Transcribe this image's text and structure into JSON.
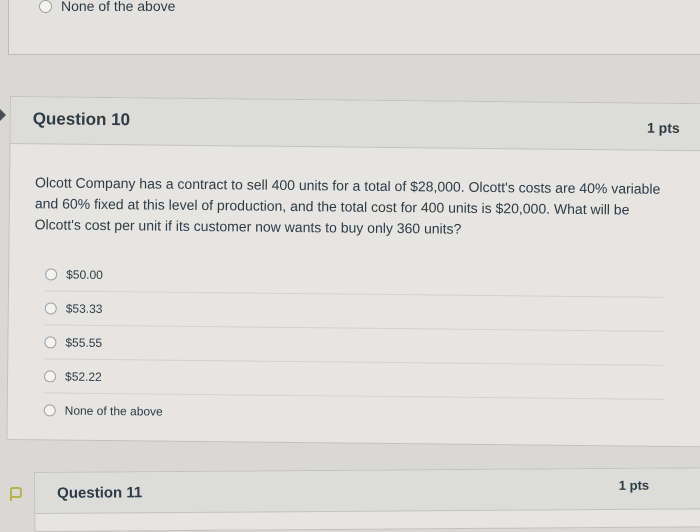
{
  "previous_question": {
    "last_answer": "None of the above"
  },
  "question10": {
    "title": "Question 10",
    "points": "1 pts",
    "text": "Olcott Company has a contract to sell 400 units for a total of $28,000. Olcott's costs are 40% variable and 60% fixed at this level of production, and the total cost for 400 units is $20,000. What will be Olcott's cost per unit if its customer now wants to buy only 360 units?",
    "answers": [
      "$50.00",
      "$53.33",
      "$55.55",
      "$52.22",
      "None of the above"
    ]
  },
  "question11": {
    "title": "Question 11",
    "points": "1 pts"
  },
  "colors": {
    "text": "#2d3b45",
    "card": "#e6e5e2",
    "header": "#dcdcd9"
  },
  "icons": {
    "flag": "flag-icon",
    "current": "caret-left-icon"
  }
}
